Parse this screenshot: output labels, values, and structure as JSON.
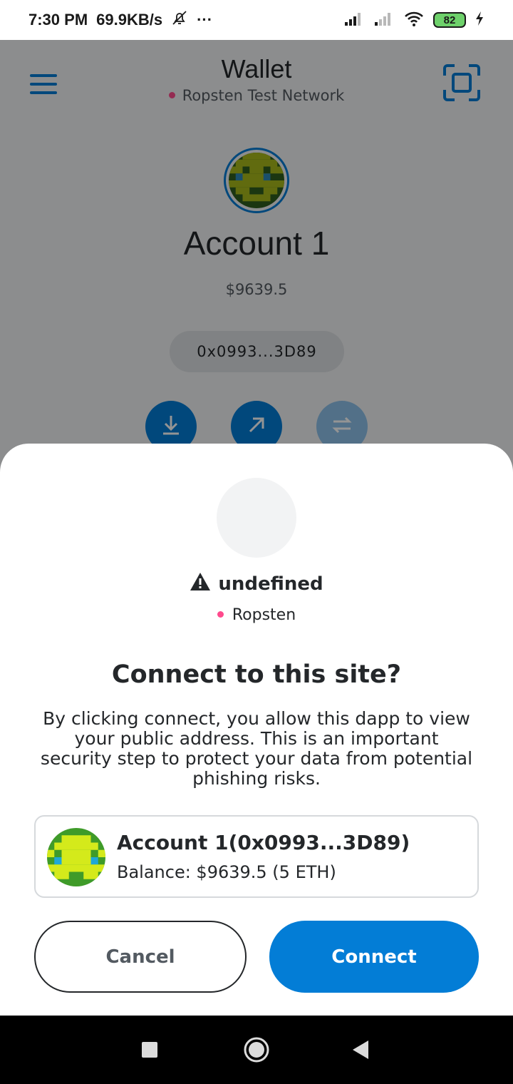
{
  "status_bar": {
    "time": "7:30 PM",
    "speed": "69.9KB/s",
    "more": "···",
    "battery": "82",
    "icons": [
      "mute-bell-icon",
      "signal-icon",
      "signal-icon",
      "wifi-icon",
      "battery-icon",
      "charging-icon"
    ]
  },
  "wallet": {
    "title": "Wallet",
    "network": "Ropsten Test Network",
    "account_name": "Account 1",
    "fiat_balance": "$9639.5",
    "address": "0x0993...3D89",
    "actions": [
      "receive-icon",
      "send-icon",
      "swap-icon"
    ]
  },
  "connect": {
    "site_title": "undefined",
    "site_network": "Ropsten",
    "heading": "Connect to this site?",
    "description": "By clicking connect, you allow this dapp to view your public address. This is an important security step to protect your data from potential phishing risks.",
    "account_label": "Account 1(0x0993...3D89)",
    "balance_label": "Balance: $9639.5 (5 ETH)",
    "cancel_label": "Cancel",
    "connect_label": "Connect"
  },
  "colors": {
    "accent": "#037dd6",
    "network_dot": "#ff4a8d",
    "overlay": "rgba(0,0,0,0.42)"
  },
  "nav_bar": {
    "icons": [
      "recents-icon",
      "home-icon",
      "back-icon"
    ]
  }
}
